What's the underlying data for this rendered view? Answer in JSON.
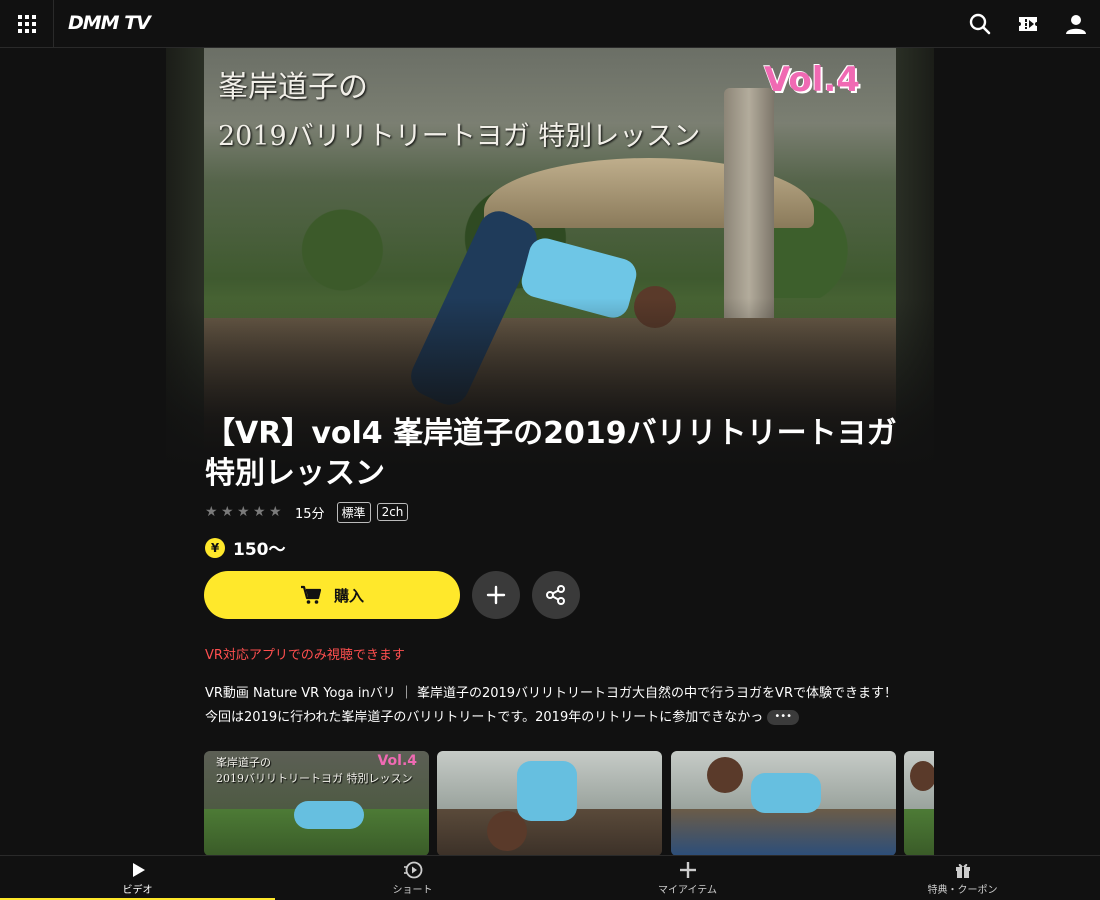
{
  "header": {
    "logo_text": "DMM TV",
    "menu_icon": "grid-menu-icon",
    "search_icon": "search-icon",
    "ticket_icon": "ticket-icon",
    "account_icon": "user-icon"
  },
  "hero": {
    "overlay_line1": "峯岸道子の",
    "overlay_line2": "2019バリリトリートヨガ 特別レッスン",
    "overlay_vol": "Vol.4"
  },
  "content": {
    "title": "【VR】vol4 峯岸道子の2019バリリトリートヨガ 特別レッスン",
    "rating_stars": 0,
    "duration": "15分",
    "quality_tag": "標準",
    "audio_tag": "2ch",
    "price": "150〜",
    "yen_symbol": "¥"
  },
  "actions": {
    "buy_label": "購入",
    "add_icon": "plus-icon",
    "share_icon": "share-icon"
  },
  "vr_note": "VR対応アプリでのみ視聴できます",
  "description": "VR動画 Nature VR Yoga inバリ ｜ 峯岸道子の2019バリリトリートヨガ大自然の中で行うヨガをVRで体験できます！今回は2019に行われた峯岸道子のバリリトリートです。2019年のリトリートに参加できなかっ",
  "more_label": "•••",
  "thumbnails": {
    "first_line1": "峯岸道子の",
    "first_line2": "2019バリリトリートヨガ 特別レッスン",
    "first_vol": "Vol.4"
  },
  "bottom_nav": [
    {
      "label": "ビデオ",
      "icon": "play-icon",
      "active": true
    },
    {
      "label": "ショート",
      "icon": "short-play-icon",
      "active": false
    },
    {
      "label": "マイアイテム",
      "icon": "plus-icon",
      "active": false
    },
    {
      "label": "特典・クーポン",
      "icon": "gift-icon",
      "active": false
    }
  ],
  "colors": {
    "accent_yellow": "#ffe82b",
    "note_red": "#ff4f4f",
    "background": "#111111"
  }
}
